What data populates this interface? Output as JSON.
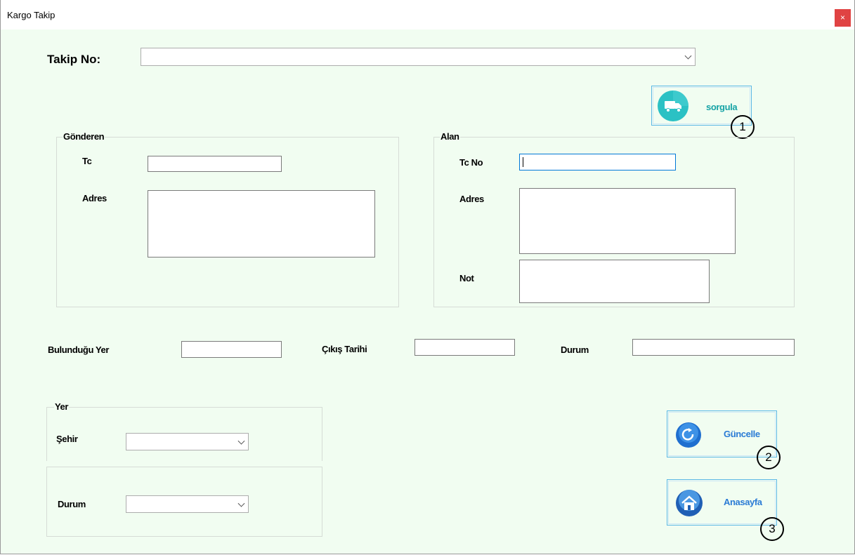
{
  "window": {
    "title": "Kargo Takip",
    "close_label": "×"
  },
  "tracking": {
    "label": "Takip No:",
    "value": ""
  },
  "query_button": {
    "label": "sorgula",
    "icon": "truck-icon",
    "marker": "1"
  },
  "sender": {
    "title": "Gönderen",
    "tc_label": "Tc",
    "tc_value": "",
    "address_label": "Adres",
    "address_value": ""
  },
  "receiver": {
    "title": "Alan",
    "tc_label": "Tc No",
    "tc_value": "",
    "address_label": "Adres",
    "address_value": "",
    "note_label": "Not",
    "note_value": ""
  },
  "status_row": {
    "location_label": "Bulunduğu Yer",
    "location_value": "",
    "departure_label": "Çıkış Tarihi",
    "departure_value": "",
    "status_label": "Durum",
    "status_value": ""
  },
  "place": {
    "title": "Yer",
    "city_label": "Şehir",
    "city_value": "",
    "status_label": "Durum",
    "status_value": ""
  },
  "update_button": {
    "label": "Güncelle",
    "icon": "refresh-icon",
    "marker": "2"
  },
  "home_button": {
    "label": "Anasayfa",
    "icon": "home-icon",
    "marker": "3"
  },
  "colors": {
    "button_text": "#2a7bd5",
    "query_text": "#16a3a6",
    "close_bg": "#e04343",
    "window_bg": "#f1fdf1"
  }
}
